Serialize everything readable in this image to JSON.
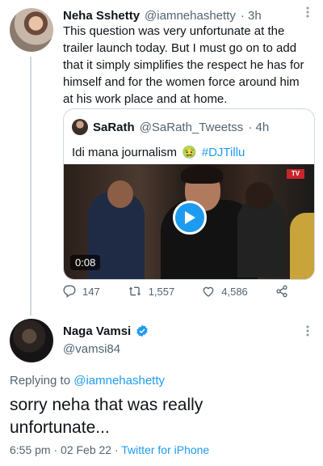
{
  "tweet1": {
    "name": "Neha Sshetty",
    "handle": "@iamnehashetty",
    "time": "· 3h",
    "text_lines": [
      "This question was very unfortunate at the",
      "trailer launch today. But I must go on to add",
      "that it simply simplifies the respect he has for",
      "himself and for the women force around him",
      "at his work place and at home."
    ],
    "quote": {
      "name": "SaRath",
      "handle": "@SaRath_Tweetss",
      "time": "· 4h",
      "text": "Idi mana journalism",
      "emoji": "🤢",
      "hashtag": "#DJTillu",
      "video_duration": "0:08"
    },
    "actions": {
      "replies": "147",
      "retweets": "1,557",
      "likes": "4,586"
    }
  },
  "tweet2": {
    "name": "Naga Vamsi",
    "handle": "@vamsi84",
    "replying_prefix": "Replying to",
    "replying_handle": "@iamnehashetty",
    "text_lines": [
      "sorry neha that was really",
      "unfortunate..."
    ],
    "time": "6:55 pm · 02 Feb 22 ·",
    "source": "Twitter for iPhone"
  },
  "icons": {
    "more": "more-horizontal-icon",
    "verified": "verified-badge-icon",
    "reply": "reply-icon",
    "retweet": "retweet-icon",
    "like": "heart-icon",
    "share": "share-icon",
    "play": "play-icon"
  },
  "colors": {
    "accent": "#1d9bf0",
    "text": "#0f1419",
    "muted": "#536471",
    "border": "#cfd9de"
  }
}
